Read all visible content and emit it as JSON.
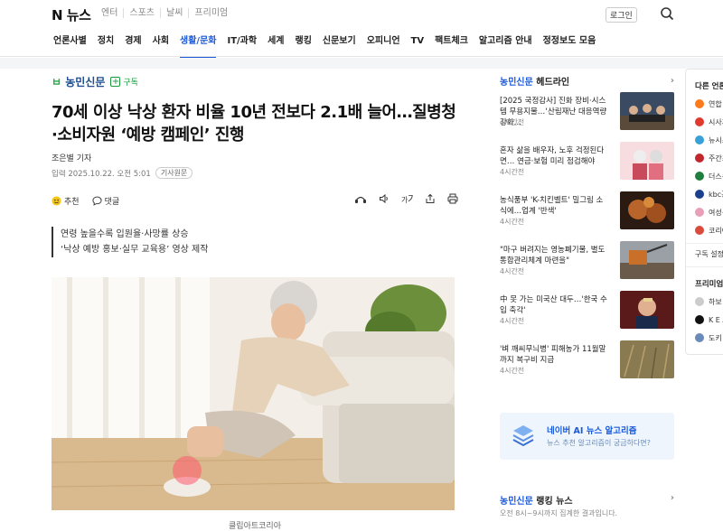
{
  "header": {
    "logo": "N 뉴스",
    "top_nav": [
      "엔터",
      "스포츠",
      "날씨",
      "프리미엄"
    ],
    "login": "로그인",
    "nav": [
      "언론사별",
      "정치",
      "경제",
      "사회",
      "생활/문화",
      "IT/과학",
      "세계",
      "랭킹",
      "신문보기",
      "오피니언",
      "TV",
      "팩트체크",
      "알고리즘 안내",
      "정정보도 모음"
    ],
    "active_nav": "생활/문화"
  },
  "article": {
    "press": "농민신문",
    "subscribe": "구독",
    "title": "70세 이상 낙상 환자 비율 10년 전보다 2.1배 늘어…질병청·소비자원 ‘예방 캠페인’ 진행",
    "byline": "조은별 기자",
    "date": "입력 2025.10.22. 오전 5:01",
    "source_badge": "기사원문",
    "reaction_label": "추천",
    "comment_label": "댓글",
    "lede": [
      "연령 높을수록 입원율·사망률 상승",
      "‘낙상 예방 홍보·실무 교육용’ 영상 제작"
    ],
    "photo_caption": "클립아트코리아"
  },
  "sidebar": {
    "press": "농민신문",
    "headline_title": "헤드라인",
    "items": [
      {
        "title": "[2025 국정감사] 진화 장비·시스템 무용지물…‘산림재난 대응역량 강화…",
        "time": "4시간전"
      },
      {
        "title": "혼자 삶을 배우자, 노후 걱정된다면… 연금·보험 미리 점검해야",
        "time": "4시간전"
      },
      {
        "title": "농식품부 'K-치킨벨트' 밀그림 소식에…업계 '반색'",
        "time": "4시간전"
      },
      {
        "title": "\"마구 버려지는 영농폐기물, 별도 통합관리체계 마련을\"",
        "time": "4시간전"
      },
      {
        "title": "中 못 가는 미국산 대두…'한국 수입 축각'",
        "time": "4시간전"
      },
      {
        "title": "'벼 깨씨무늬병' 피해농가 11월말까지 복구비 지급",
        "time": "4시간전"
      }
    ],
    "banner_title": "네이버 AI 뉴스 알고리즘",
    "banner_sub": "뉴스 추천 알고리즘이 궁금하다면?",
    "rank_press": "농민신문",
    "rank_title": "랭킹 뉴스",
    "rank_desc": "오전 8시~9시까지 집계한 결과입니다."
  },
  "far_panel": {
    "title": "다른 언론사",
    "outlets": [
      {
        "name": "연합",
        "color": "#ff7a1a"
      },
      {
        "name": "시사저",
        "color": "#e03a2f"
      },
      {
        "name": "뉴시스",
        "color": "#3aa0d8"
      },
      {
        "name": "주간조",
        "color": "#c1272d"
      },
      {
        "name": "더스쿠",
        "color": "#1e7f3f"
      },
      {
        "name": "kbc광",
        "color": "#1b3f8f"
      },
      {
        "name": "여성신",
        "color": "#e8a0b8"
      },
      {
        "name": "코리아",
        "color": "#d94b3a"
      }
    ],
    "subscribe_settings": "구독 설정",
    "premium_title": "프리미엄 콘",
    "premium_items": [
      "하보",
      "K E A",
      "도키"
    ]
  }
}
